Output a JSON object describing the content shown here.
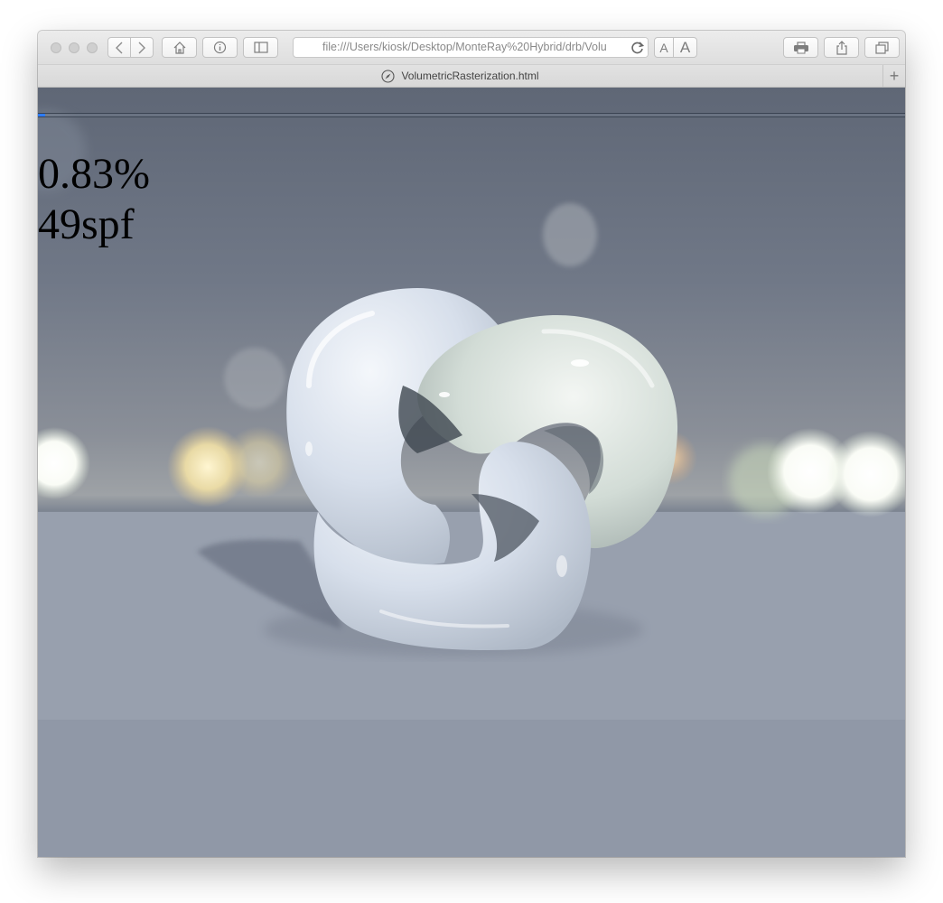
{
  "browser": {
    "address_url": "file:///Users/kiosk/Desktop/MonteRay%20Hybrid/drb/Volu",
    "tab_title": "VolumetricRasterization.html",
    "font_small_label": "A",
    "font_large_label": "A",
    "new_tab_label": "+"
  },
  "render": {
    "progress_text": "0.83%",
    "progress_fraction": 0.0083,
    "spf_text": "49spf",
    "scene_description_icon": "trefoil-knot-render"
  },
  "colors": {
    "progress_fill": "#2d7bff",
    "sky_top": "#6a7280",
    "floor": "#8e96a4"
  }
}
